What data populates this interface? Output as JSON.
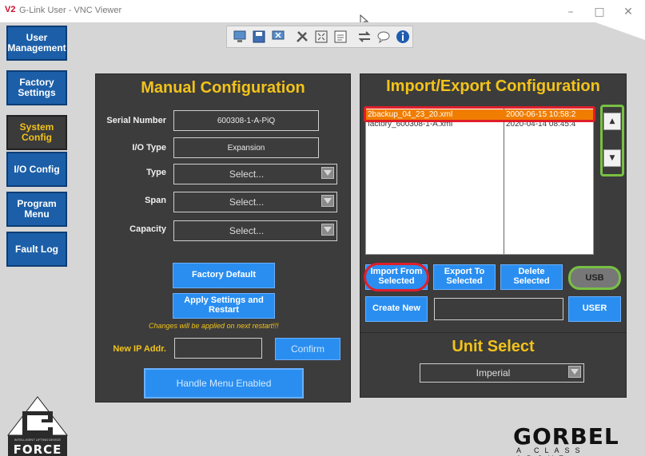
{
  "window": {
    "logo_text": "V2",
    "title": "G-Link User - VNC Viewer",
    "minimize": "–",
    "maximize": "□",
    "close": "✕"
  },
  "toolbar": {
    "icons": [
      "computer-icon",
      "save-icon",
      "screen-close-icon",
      "tools-icon",
      "fullscreen-icon",
      "ctrl-alt-del-icon",
      "swap-icon",
      "chat-icon",
      "info-icon"
    ]
  },
  "sidebar": {
    "items": [
      {
        "label": "User Management"
      },
      {
        "label": "Factory Settings"
      },
      {
        "label": "System Config",
        "active": true
      },
      {
        "label": "I/O Config"
      },
      {
        "label": "Program Menu"
      },
      {
        "label": "Fault Log"
      }
    ]
  },
  "manual": {
    "title": "Manual Configuration",
    "serial_label": "Serial Number",
    "serial_value": "600308-1-A-PiQ",
    "io_type_label": "I/O Type",
    "io_type_value": "Expansion",
    "type_label": "Type",
    "type_value": "Select...",
    "span_label": "Span",
    "span_value": "Select...",
    "capacity_label": "Capacity",
    "capacity_value": "Select...",
    "factory_default": "Factory Default",
    "apply_restart": "Apply Settings and Restart",
    "note": "Changes will be applied on next restart!!!",
    "ip_label": "New IP Addr.",
    "ip_value": "",
    "confirm": "Confirm",
    "handle_menu": "Handle Menu Enabled"
  },
  "import_export": {
    "title": "Import/Export Configuration",
    "files": [
      {
        "name": "2backup_04_23_20.xml",
        "date": "2000-06-15 10:58:2",
        "selected": true
      },
      {
        "name": "factory_600308-1-A.xml",
        "date": "2020-04-14 08:45:4",
        "selected": false
      }
    ],
    "scroll_up": "▲",
    "scroll_down": "▼",
    "import_selected": "Import From Selected",
    "export_selected": "Export To Selected",
    "delete_selected": "Delete Selected",
    "usb": "USB",
    "create_new": "Create New",
    "new_name_value": "",
    "user": "USER"
  },
  "unit_select": {
    "title": "Unit Select",
    "value": "Imperial"
  },
  "branding": {
    "force_tagline": "INTELLIGENT LIFTING DEVICE",
    "force_name": "FORCE",
    "gorbel": "GORBEL",
    "gorbel_tagline": "A CLASS ABOVE"
  },
  "colors": {
    "accent": "#f2c31a",
    "sidebar_blue": "#1c5fa8",
    "button_blue": "#2a8ef0",
    "panel_bg": "#3c3c3c",
    "selection": "#f07d00",
    "highlight_red": "#e01e2a",
    "highlight_green": "#78c043"
  }
}
